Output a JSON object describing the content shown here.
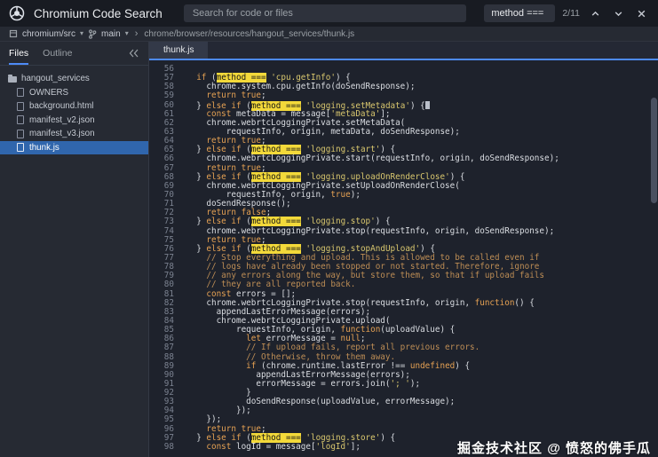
{
  "topbar": {
    "app_title": "Chromium Code Search",
    "search_placeholder": "Search for code or files",
    "find": {
      "query": "method ===",
      "count": "2/11"
    }
  },
  "breadcrumb": {
    "repo": "chromium/src",
    "branch": "main",
    "path": "chrome/browser/resources/hangout_services/thunk.js"
  },
  "icons": {
    "caret_down": "▾",
    "separator": "›"
  },
  "sidebar": {
    "tabs": [
      {
        "label": "Files",
        "active": true
      },
      {
        "label": "Outline",
        "active": false
      }
    ],
    "files": [
      {
        "name": "hangout_services",
        "type": "folder",
        "selected": false,
        "indent": 0
      },
      {
        "name": "OWNERS",
        "type": "file",
        "selected": false,
        "indent": 1
      },
      {
        "name": "background.html",
        "type": "file",
        "selected": false,
        "indent": 1
      },
      {
        "name": "manifest_v2.json",
        "type": "file",
        "selected": false,
        "indent": 1
      },
      {
        "name": "manifest_v3.json",
        "type": "file",
        "selected": false,
        "indent": 1
      },
      {
        "name": "thunk.js",
        "type": "file",
        "selected": true,
        "indent": 1
      }
    ]
  },
  "editor": {
    "tab": "thunk.js",
    "first_line": 56,
    "lines": [
      [],
      [
        [
          "p",
          "  "
        ],
        [
          "k",
          "if"
        ],
        [
          "p",
          " ("
        ],
        [
          "h",
          "method ==="
        ],
        [
          "p",
          " "
        ],
        [
          "s",
          "'cpu.getInfo'"
        ],
        [
          "p",
          ") {"
        ]
      ],
      [
        [
          "p",
          "    chrome.system.cpu.getInfo(doSendResponse);"
        ]
      ],
      [
        [
          "p",
          "    "
        ],
        [
          "k",
          "return"
        ],
        [
          "p",
          " "
        ],
        [
          "k",
          "true"
        ],
        [
          "p",
          ";"
        ]
      ],
      [
        [
          "p",
          "  } "
        ],
        [
          "k",
          "else"
        ],
        [
          "p",
          " "
        ],
        [
          "k",
          "if"
        ],
        [
          "p",
          " ("
        ],
        [
          "h",
          "method ==="
        ],
        [
          "p",
          " "
        ],
        [
          "s",
          "'logging.setMetadata'"
        ],
        [
          "p",
          ") {"
        ],
        [
          "cur",
          ""
        ]
      ],
      [
        [
          "p",
          "    "
        ],
        [
          "k",
          "const"
        ],
        [
          "p",
          " metaData = message["
        ],
        [
          "s",
          "'metaData'"
        ],
        [
          "p",
          "];"
        ]
      ],
      [
        [
          "p",
          "    chrome.webrtcLoggingPrivate.setMetaData("
        ]
      ],
      [
        [
          "p",
          "        requestInfo, origin, metaData, doSendResponse);"
        ]
      ],
      [
        [
          "p",
          "    "
        ],
        [
          "k",
          "return"
        ],
        [
          "p",
          " "
        ],
        [
          "k",
          "true"
        ],
        [
          "p",
          ";"
        ]
      ],
      [
        [
          "p",
          "  } "
        ],
        [
          "k",
          "else"
        ],
        [
          "p",
          " "
        ],
        [
          "k",
          "if"
        ],
        [
          "p",
          " ("
        ],
        [
          "h",
          "method ==="
        ],
        [
          "p",
          " "
        ],
        [
          "s",
          "'logging.start'"
        ],
        [
          "p",
          ") {"
        ]
      ],
      [
        [
          "p",
          "    chrome.webrtcLoggingPrivate.start(requestInfo, origin, doSendResponse);"
        ]
      ],
      [
        [
          "p",
          "    "
        ],
        [
          "k",
          "return"
        ],
        [
          "p",
          " "
        ],
        [
          "k",
          "true"
        ],
        [
          "p",
          ";"
        ]
      ],
      [
        [
          "p",
          "  } "
        ],
        [
          "k",
          "else"
        ],
        [
          "p",
          " "
        ],
        [
          "k",
          "if"
        ],
        [
          "p",
          " ("
        ],
        [
          "h",
          "method ==="
        ],
        [
          "p",
          " "
        ],
        [
          "s",
          "'logging.uploadOnRenderClose'"
        ],
        [
          "p",
          ") {"
        ]
      ],
      [
        [
          "p",
          "    chrome.webrtcLoggingPrivate.setUploadOnRenderClose("
        ]
      ],
      [
        [
          "p",
          "        requestInfo, origin, "
        ],
        [
          "k",
          "true"
        ],
        [
          "p",
          ");"
        ]
      ],
      [
        [
          "p",
          "    doSendResponse();"
        ]
      ],
      [
        [
          "p",
          "    "
        ],
        [
          "k",
          "return"
        ],
        [
          "p",
          " "
        ],
        [
          "k",
          "false"
        ],
        [
          "p",
          ";"
        ]
      ],
      [
        [
          "p",
          "  } "
        ],
        [
          "k",
          "else"
        ],
        [
          "p",
          " "
        ],
        [
          "k",
          "if"
        ],
        [
          "p",
          " ("
        ],
        [
          "h",
          "method ==="
        ],
        [
          "p",
          " "
        ],
        [
          "s",
          "'logging.stop'"
        ],
        [
          "p",
          ") {"
        ]
      ],
      [
        [
          "p",
          "    chrome.webrtcLoggingPrivate.stop(requestInfo, origin, doSendResponse);"
        ]
      ],
      [
        [
          "p",
          "    "
        ],
        [
          "k",
          "return"
        ],
        [
          "p",
          " "
        ],
        [
          "k",
          "true"
        ],
        [
          "p",
          ";"
        ]
      ],
      [
        [
          "p",
          "  } "
        ],
        [
          "k",
          "else"
        ],
        [
          "p",
          " "
        ],
        [
          "k",
          "if"
        ],
        [
          "p",
          " ("
        ],
        [
          "h",
          "method ==="
        ],
        [
          "p",
          " "
        ],
        [
          "s",
          "'logging.stopAndUpload'"
        ],
        [
          "p",
          ") {"
        ]
      ],
      [
        [
          "p",
          "    "
        ],
        [
          "c",
          "// Stop everything and upload. This is allowed to be called even if"
        ]
      ],
      [
        [
          "p",
          "    "
        ],
        [
          "c",
          "// logs have already been stopped or not started. Therefore, ignore"
        ]
      ],
      [
        [
          "p",
          "    "
        ],
        [
          "c",
          "// any errors along the way, but store them, so that if upload fails"
        ]
      ],
      [
        [
          "p",
          "    "
        ],
        [
          "c",
          "// they are all reported back."
        ]
      ],
      [
        [
          "p",
          "    "
        ],
        [
          "k",
          "const"
        ],
        [
          "p",
          " errors = [];"
        ]
      ],
      [
        [
          "p",
          "    chrome.webrtcLoggingPrivate.stop(requestInfo, origin, "
        ],
        [
          "k",
          "function"
        ],
        [
          "p",
          "() {"
        ]
      ],
      [
        [
          "p",
          "      appendLastErrorMessage(errors);"
        ]
      ],
      [
        [
          "p",
          "      chrome.webrtcLoggingPrivate.upload("
        ]
      ],
      [
        [
          "p",
          "          requestInfo, origin, "
        ],
        [
          "k",
          "function"
        ],
        [
          "p",
          "(uploadValue) {"
        ]
      ],
      [
        [
          "p",
          "            "
        ],
        [
          "k",
          "let"
        ],
        [
          "p",
          " errorMessage = "
        ],
        [
          "k",
          "null"
        ],
        [
          "p",
          ";"
        ]
      ],
      [
        [
          "p",
          "            "
        ],
        [
          "c",
          "// If upload fails, report all previous errors."
        ]
      ],
      [
        [
          "p",
          "            "
        ],
        [
          "c",
          "// Otherwise, throw them away."
        ]
      ],
      [
        [
          "p",
          "            "
        ],
        [
          "k",
          "if"
        ],
        [
          "p",
          " (chrome.runtime.lastError !== "
        ],
        [
          "k",
          "undefined"
        ],
        [
          "p",
          ") {"
        ]
      ],
      [
        [
          "p",
          "              appendLastErrorMessage(errors);"
        ]
      ],
      [
        [
          "p",
          "              errorMessage = errors.join("
        ],
        [
          "s",
          "'; '"
        ],
        [
          "p",
          ");"
        ]
      ],
      [
        [
          "p",
          "            }"
        ]
      ],
      [
        [
          "p",
          "            doSendResponse(uploadValue, errorMessage);"
        ]
      ],
      [
        [
          "p",
          "          });"
        ]
      ],
      [
        [
          "p",
          "    });"
        ]
      ],
      [
        [
          "p",
          "    "
        ],
        [
          "k",
          "return"
        ],
        [
          "p",
          " "
        ],
        [
          "k",
          "true"
        ],
        [
          "p",
          ";"
        ]
      ],
      [
        [
          "p",
          "  } "
        ],
        [
          "k",
          "else"
        ],
        [
          "p",
          " "
        ],
        [
          "k",
          "if"
        ],
        [
          "p",
          " ("
        ],
        [
          "h",
          "method ==="
        ],
        [
          "p",
          " "
        ],
        [
          "s",
          "'logging.store'"
        ],
        [
          "p",
          ") {"
        ]
      ],
      [
        [
          "p",
          "    "
        ],
        [
          "k",
          "const"
        ],
        [
          "p",
          " logId = message["
        ],
        [
          "s",
          "'logId'"
        ],
        [
          "p",
          "];"
        ]
      ]
    ]
  },
  "watermark": "掘金技术社区 @ 愤怒的佛手瓜",
  "colors": {
    "accent": "#4d8af5",
    "sel": "#3066ad",
    "hl": "#f3d93a",
    "kw": "#e5a153",
    "str": "#d9c76e",
    "cmt": "#bd8d55",
    "bgtop": "#181b22",
    "bgcrumb": "#262a33",
    "bgside": "#262a33",
    "bgeditor": "#1e222c",
    "bgtabbar": "#242834",
    "txt": "#dadde2",
    "muted": "#9aa0a6",
    "ln": "#7b8290"
  }
}
